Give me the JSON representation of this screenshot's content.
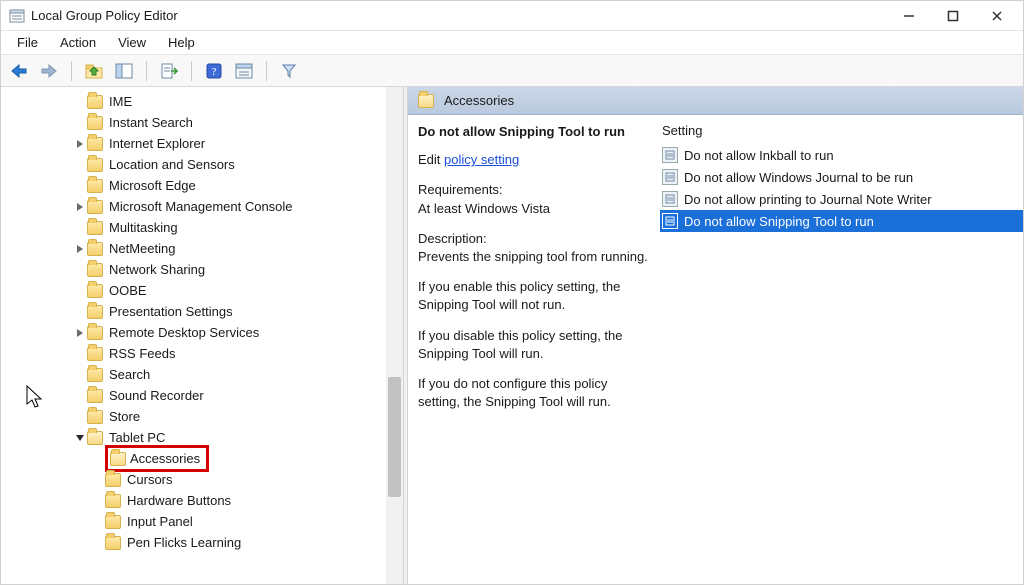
{
  "window": {
    "title": "Local Group Policy Editor"
  },
  "menubar": [
    "File",
    "Action",
    "View",
    "Help"
  ],
  "toolbar": {
    "back": "Back",
    "forward": "Forward",
    "up": "Up one level",
    "show_hide_tree": "Show/Hide Console Tree",
    "export": "Export List",
    "help": "Help",
    "properties": "Properties",
    "filter": "Filter"
  },
  "tree": [
    {
      "depth": 4,
      "twisty": "",
      "label": "IME"
    },
    {
      "depth": 4,
      "twisty": "",
      "label": "Instant Search"
    },
    {
      "depth": 4,
      "twisty": ">",
      "label": "Internet Explorer"
    },
    {
      "depth": 4,
      "twisty": "",
      "label": "Location and Sensors"
    },
    {
      "depth": 4,
      "twisty": "",
      "label": "Microsoft Edge"
    },
    {
      "depth": 4,
      "twisty": ">",
      "label": "Microsoft Management Console"
    },
    {
      "depth": 4,
      "twisty": "",
      "label": "Multitasking"
    },
    {
      "depth": 4,
      "twisty": ">",
      "label": "NetMeeting"
    },
    {
      "depth": 4,
      "twisty": "",
      "label": "Network Sharing"
    },
    {
      "depth": 4,
      "twisty": "",
      "label": "OOBE"
    },
    {
      "depth": 4,
      "twisty": "",
      "label": "Presentation Settings"
    },
    {
      "depth": 4,
      "twisty": ">",
      "label": "Remote Desktop Services"
    },
    {
      "depth": 4,
      "twisty": "",
      "label": "RSS Feeds"
    },
    {
      "depth": 4,
      "twisty": "",
      "label": "Search"
    },
    {
      "depth": 4,
      "twisty": "",
      "label": "Sound Recorder"
    },
    {
      "depth": 4,
      "twisty": "",
      "label": "Store"
    },
    {
      "depth": 4,
      "twisty": "v",
      "label": "Tablet PC",
      "open": true
    },
    {
      "depth": 5,
      "twisty": "",
      "label": "Accessories",
      "highlight": true
    },
    {
      "depth": 5,
      "twisty": "",
      "label": "Cursors"
    },
    {
      "depth": 5,
      "twisty": "",
      "label": "Hardware Buttons"
    },
    {
      "depth": 5,
      "twisty": "",
      "label": "Input Panel"
    },
    {
      "depth": 5,
      "twisty": "",
      "label": "Pen Flicks Learning"
    }
  ],
  "right": {
    "header": "Accessories",
    "detail": {
      "title": "Do not allow Snipping Tool to run",
      "edit_prefix": "Edit",
      "edit_link": "policy setting",
      "requirements_label": "Requirements:",
      "requirements_value": "At least Windows Vista",
      "description_label": "Description:",
      "description_1": "Prevents the snipping tool from running.",
      "description_2": "If you enable this policy setting, the Snipping Tool will not run.",
      "description_3": "If you disable this policy setting, the Snipping Tool will run.",
      "description_4": "If you do not configure this policy setting, the Snipping Tool will run."
    },
    "settings_header": "Setting",
    "settings": [
      {
        "label": "Do not allow Inkball to run",
        "selected": false
      },
      {
        "label": "Do not allow Windows Journal to be run",
        "selected": false
      },
      {
        "label": "Do not allow printing to Journal Note Writer",
        "selected": false
      },
      {
        "label": "Do not allow Snipping Tool to run",
        "selected": true
      }
    ]
  }
}
